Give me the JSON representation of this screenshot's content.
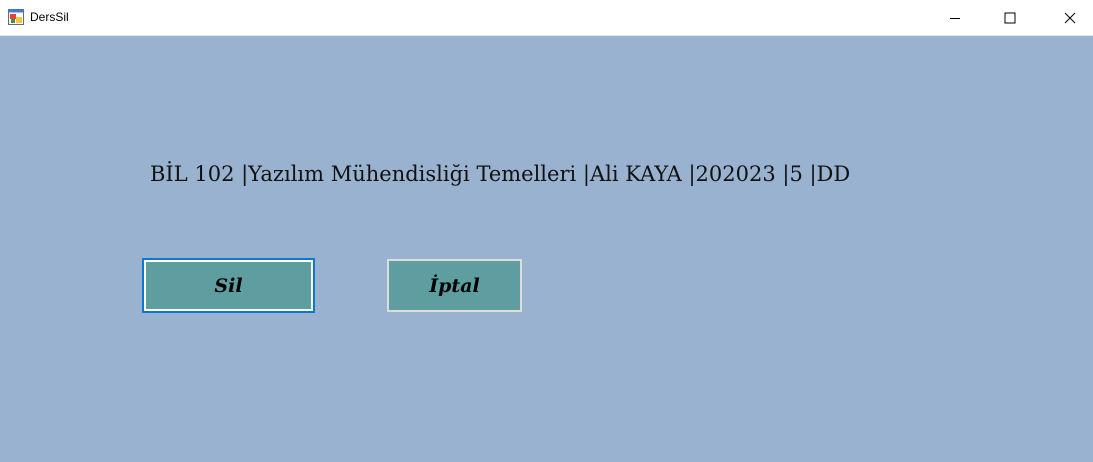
{
  "window": {
    "title": "DersSil"
  },
  "content": {
    "course_line": "BİL 102 |Yazılım Mühendisliği Temelleri |Ali KAYA |202023 |5 |DD"
  },
  "buttons": {
    "delete_label": "Sil",
    "cancel_label": "İptal"
  },
  "colors": {
    "background": "#98b2d0",
    "button": "#5f9ea0",
    "focus_border": "#0a78d7"
  },
  "icons": {
    "app": "app-icon",
    "minimize": "minimize-icon",
    "maximize": "maximize-icon",
    "close": "close-icon"
  }
}
